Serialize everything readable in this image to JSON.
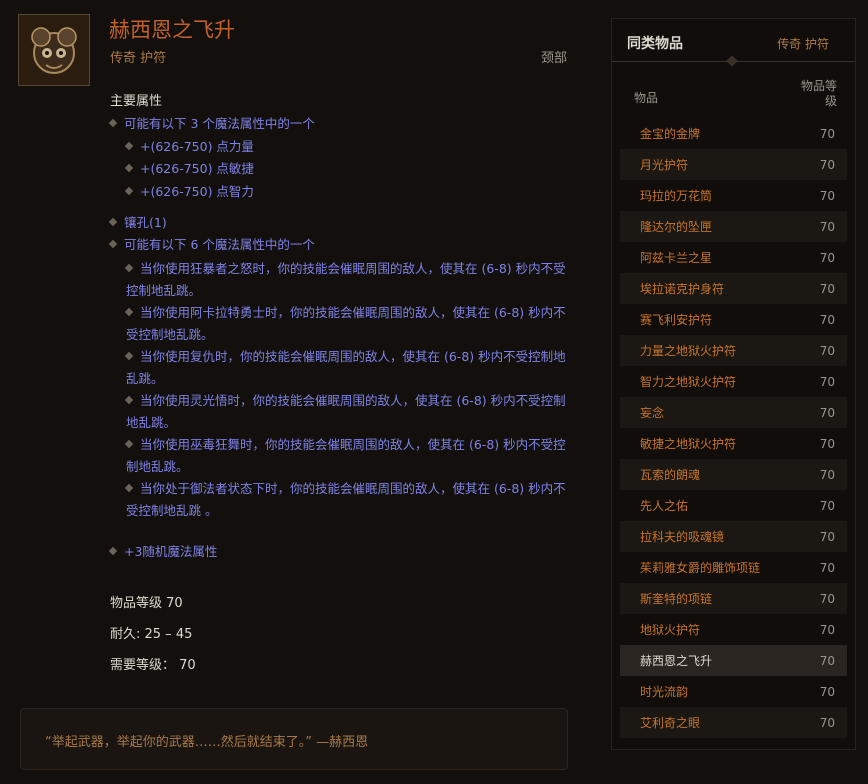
{
  "item": {
    "name": "赫西恩之飞升",
    "type": "传奇 护符",
    "slot": "颈部",
    "icon": "amulet-icon"
  },
  "primary_header": "主要属性",
  "affix_group1_intro": "可能有以下 3 个魔法属性中的一个",
  "affix_group1": [
    "+(626-750) 点力量",
    "+(626-750) 点敏捷",
    "+(626-750) 点智力"
  ],
  "socket": "镶孔(1)",
  "affix_group2_intro": "可能有以下 6 个魔法属性中的一个",
  "affix_group2": [
    "当你使用狂暴者之怒时，你的技能会催眠周围的敌人，使其在 (6-8) 秒内不受控制地乱跳。",
    "当你使用阿卡拉特勇士时，你的技能会催眠周围的敌人，使其在 (6-8) 秒内不受控制地乱跳。",
    "当你使用复仇时，你的技能会催眠周围的敌人，使其在 (6-8) 秒内不受控制地乱跳。",
    "当你使用灵光悟时，你的技能会催眠周围的敌人，使其在 (6-8) 秒内不受控制地乱跳。",
    "当你使用巫毒狂舞时，你的技能会催眠周围的敌人，使其在 (6-8) 秒内不受控制地乱跳。",
    "当你处于御法者状态下时，你的技能会催眠周围的敌人，使其在 (6-8) 秒内不受控制地乱跳 。"
  ],
  "random_affix": "+3随机魔法属性",
  "stats": {
    "item_level": "物品等级 70",
    "durability": "耐久: 25 – 45",
    "required_level": "需要等级： 70"
  },
  "flavor": "“举起武器，举起你的武器……然后就结束了。” —赫西恩",
  "sidebar": {
    "title": "同类物品",
    "subtitle": "传奇 护符",
    "col_name": "物品",
    "col_level": "物品等级",
    "items": [
      {
        "name": "金宝的金牌",
        "level": "70"
      },
      {
        "name": "月光护符",
        "level": "70"
      },
      {
        "name": "玛拉的万花筒",
        "level": "70"
      },
      {
        "name": "隆达尔的坠匣",
        "level": "70"
      },
      {
        "name": "阿兹卡兰之星",
        "level": "70"
      },
      {
        "name": "埃拉诺克护身符",
        "level": "70"
      },
      {
        "name": "赛飞利安护符",
        "level": "70"
      },
      {
        "name": "力量之地狱火护符",
        "level": "70"
      },
      {
        "name": "智力之地狱火护符",
        "level": "70"
      },
      {
        "name": "妄念",
        "level": "70"
      },
      {
        "name": "敏捷之地狱火护符",
        "level": "70"
      },
      {
        "name": "瓦索的朗魂",
        "level": "70"
      },
      {
        "name": "先人之佑",
        "level": "70"
      },
      {
        "name": "拉科夫的吸魂镜",
        "level": "70"
      },
      {
        "name": "茱莉雅女爵的雕饰项链",
        "level": "70"
      },
      {
        "name": "斯奎特的项链",
        "level": "70"
      },
      {
        "name": "地狱火护符",
        "level": "70"
      },
      {
        "name": "赫西恩之飞升",
        "level": "70",
        "current": true
      },
      {
        "name": "时光流韵",
        "level": "70"
      },
      {
        "name": "艾利奇之眼",
        "level": "70"
      }
    ]
  }
}
